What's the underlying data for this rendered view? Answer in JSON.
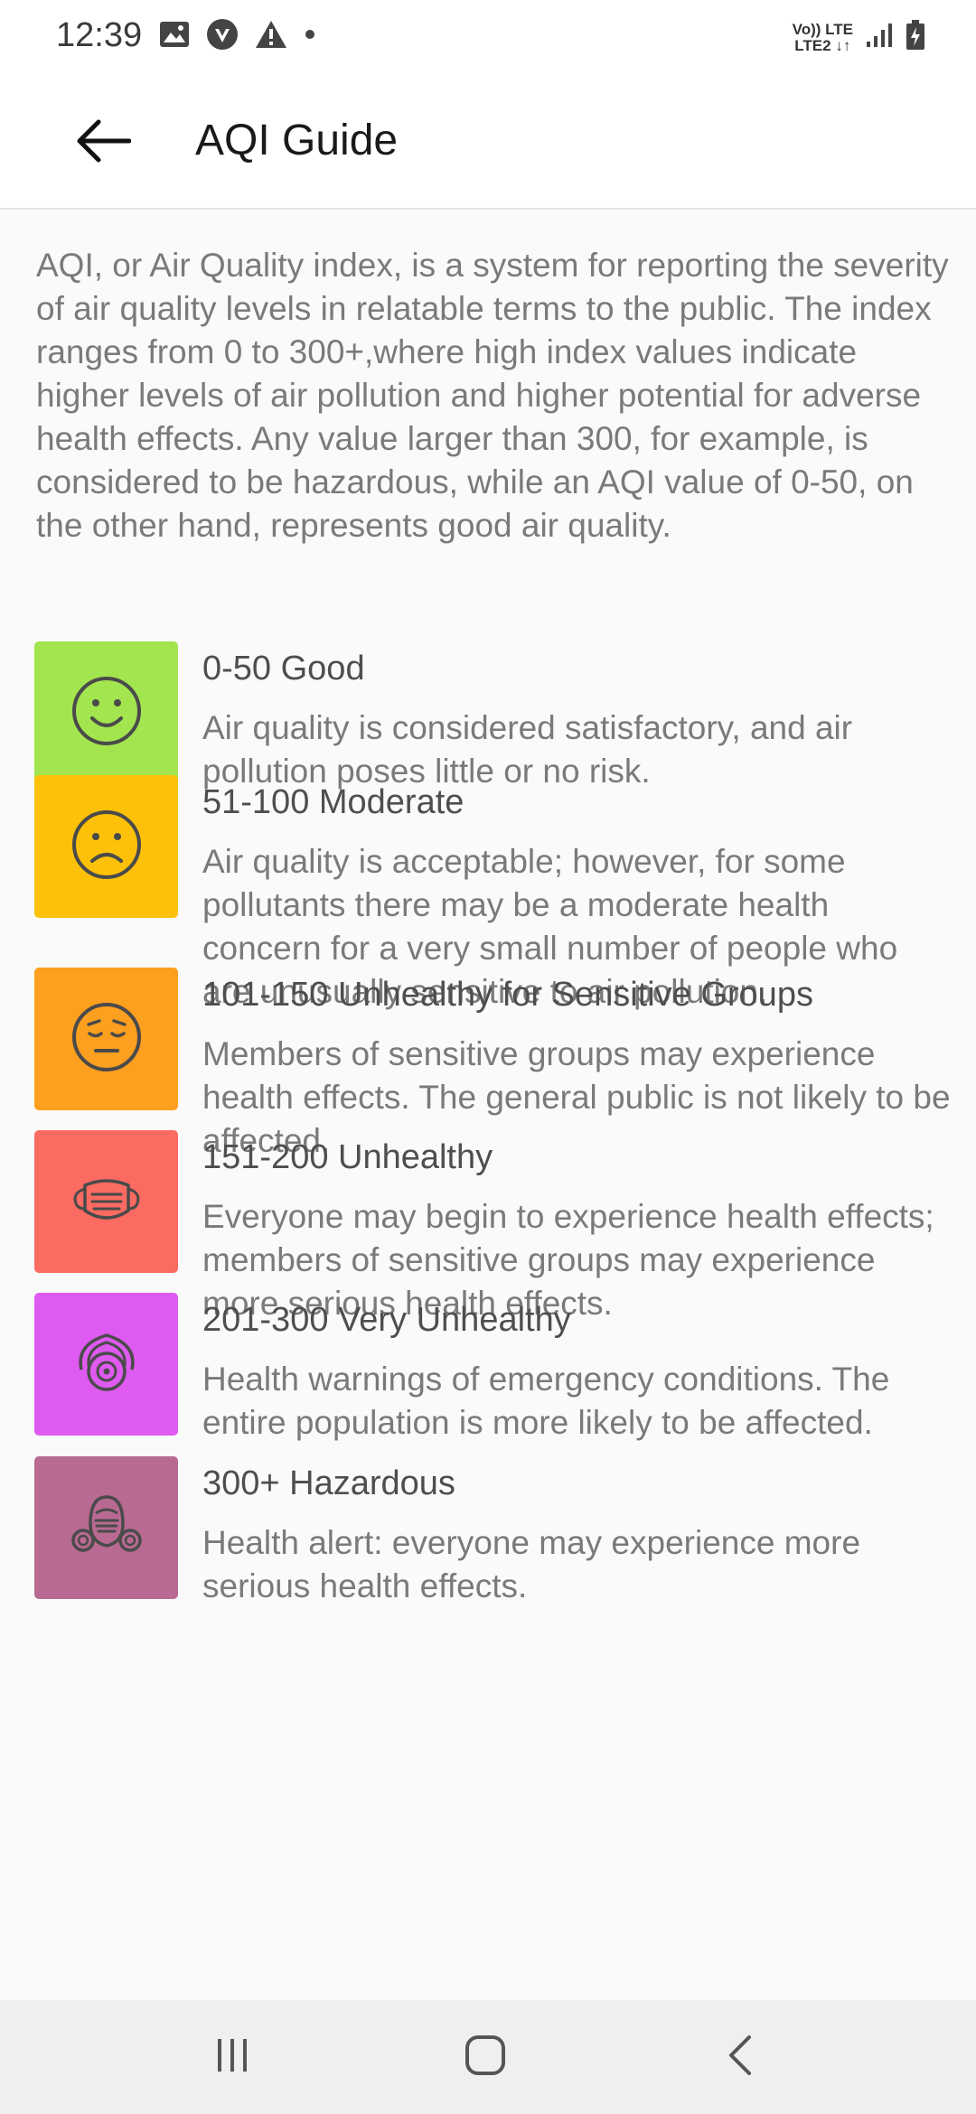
{
  "status": {
    "time": "12:39",
    "net_top": "Vo)) LTE",
    "net_bottom": "LTE2 ↓↑"
  },
  "app_bar": {
    "title": "AQI Guide"
  },
  "intro": "AQI, or Air Quality index, is a system for reporting the severity of air quality levels in relatable terms to the public. The index ranges from 0 to 300+,where high index values indicate higher levels of air pollution and higher potential for adverse health effects. Any value larger than 300, for example, is considered to be hazardous, while an AQI value of 0-50, on the other hand, represents good air quality.",
  "levels": [
    {
      "range": "0-50 Good",
      "description": "Air quality is considered satisfactory, and air pollution poses little or no risk.",
      "color": "#a3e54e",
      "icon": "smiling-face-icon"
    },
    {
      "range": "51-100 Moderate",
      "description": "Air quality is acceptable; however, for some pollutants there may be a moderate health concern for a very small number of people who are unusually sensitive to air pollution.",
      "color": "#fdc10a",
      "icon": "frowning-face-icon"
    },
    {
      "range": "101-150 Unhealthy for Sensitive Groups",
      "description": "Members of sensitive groups may experience health effects. The general public is not likely to be affected.",
      "color": "#fd9f1f",
      "icon": "unwell-face-icon"
    },
    {
      "range": "151-200 Unhealthy",
      "description": "Everyone may begin to experience health effects; members of sensitive groups may experience more serious health effects.",
      "color": "#fc6b61",
      "icon": "face-mask-icon"
    },
    {
      "range": "201-300 Very Unhealthy",
      "description": "Health warnings of emergency conditions. The entire population is more likely to be affected.",
      "color": "#df5af0",
      "icon": "respirator-mask-icon"
    },
    {
      "range": "300+ Hazardous",
      "description": "Health alert: everyone may experience more serious health effects.",
      "color": "#b96a92",
      "icon": "gas-mask-icon"
    }
  ],
  "colors": {
    "icon_stroke": "#4a4a4a",
    "nav_background": "#efefef"
  }
}
